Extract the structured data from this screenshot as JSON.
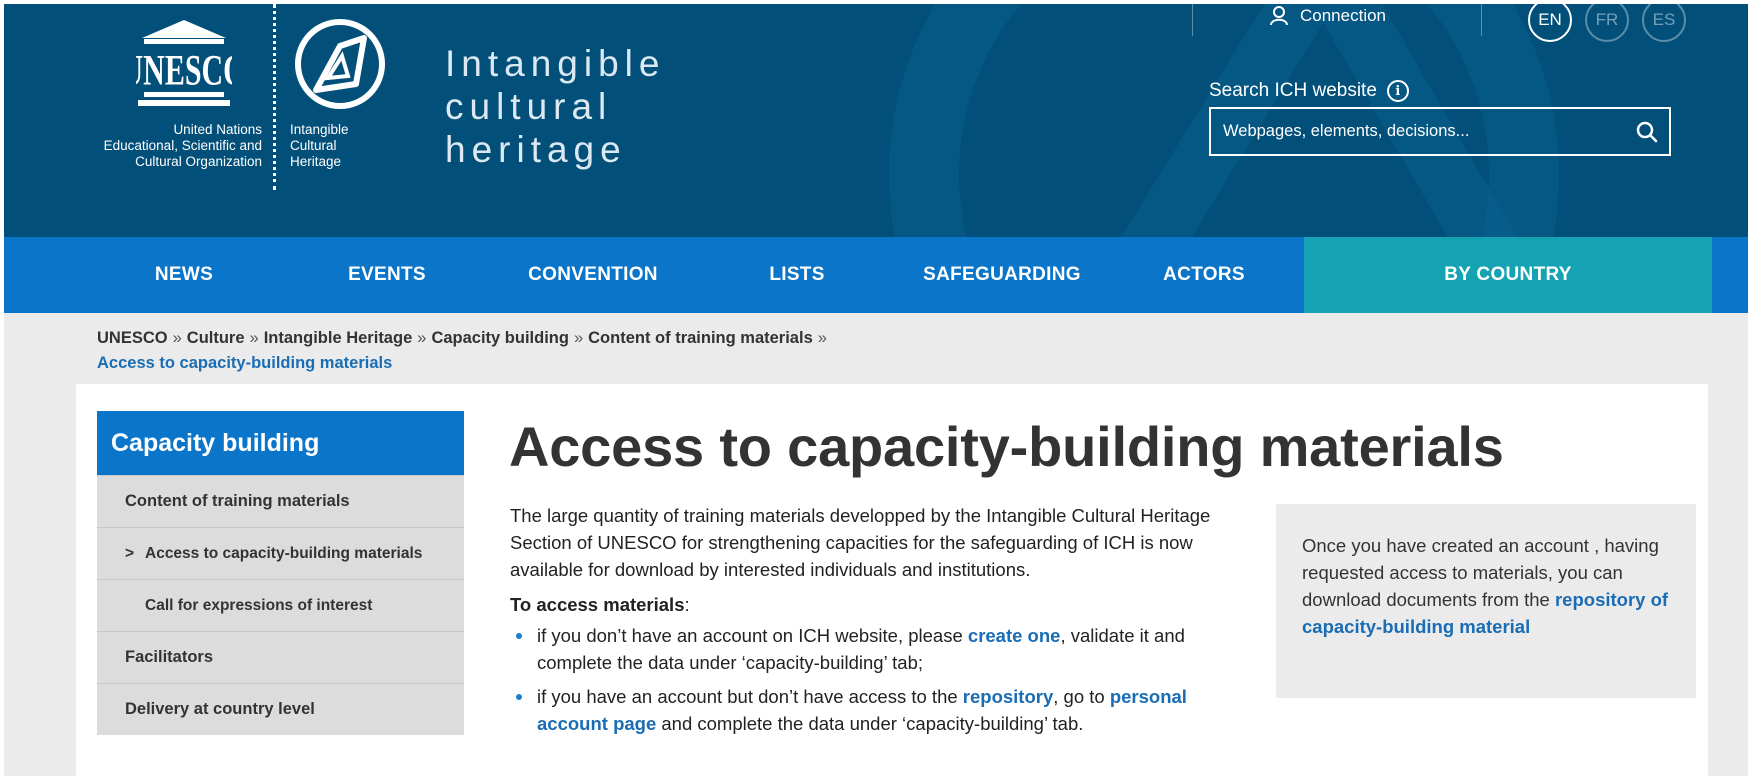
{
  "header": {
    "unesco_logo_text": "UNESCO",
    "unesco_lines": [
      "United Nations",
      "Educational, Scientific and",
      "Cultural Organization"
    ],
    "ich_lines": [
      "Intangible",
      "Cultural",
      "Heritage"
    ],
    "site_title_lines": [
      "Intangible",
      "cultural",
      "heritage"
    ],
    "connection_label": "Connection",
    "languages": [
      "EN",
      "FR",
      "ES"
    ],
    "active_language": "EN",
    "search_label": "Search ICH website",
    "search_placeholder": "Webpages, elements, decisions...",
    "icons": {
      "user": "user-icon",
      "info": "info-icon",
      "search": "search-icon"
    }
  },
  "nav": {
    "items": [
      "NEWS",
      "EVENTS",
      "CONVENTION",
      "LISTS",
      "SAFEGUARDING",
      "ACTORS",
      "BY COUNTRY"
    ]
  },
  "breadcrumb": {
    "items": [
      "UNESCO",
      "Culture",
      "Intangible Heritage",
      "Capacity building",
      "Content of training materials"
    ],
    "separator": "»",
    "current": "Access to capacity-building materials"
  },
  "sidebar": {
    "title": "Capacity building",
    "items": [
      {
        "label": "Content of training materials"
      },
      {
        "label": "Access to capacity-building materials",
        "marker": ">"
      },
      {
        "label": "Call for expressions of interest"
      },
      {
        "label": "Facilitators"
      },
      {
        "label": "Delivery at country level"
      }
    ]
  },
  "main": {
    "title": "Access to capacity-building materials",
    "intro": "The large quantity of training materials developped by the Intangible Cultural Heritage Section of UNESCO for strengthening capacities for the safeguarding of ICH is now available for download by interested individuals and institutions.",
    "access_heading": "To access materials",
    "access_colon": ":",
    "bullet1": {
      "pre": "if you don’t have an account on ICH website, please ",
      "link": "create one",
      "post": ", validate it and complete the data under ‘capacity-building’ tab;"
    },
    "bullet2": {
      "pre": "if you have an account but don’t have access to the ",
      "link1": "repository",
      "mid": ", go to ",
      "link2": "personal account page",
      "post": " and complete the data under ‘capacity-building’ tab."
    }
  },
  "aside": {
    "text": "Once you have created an account , having requested access to materials, you can download documents from the ",
    "link": "repository of capacity-building material"
  },
  "colors": {
    "header_bg": "#02507a",
    "nav_bg": "#0b75c9",
    "nav_country_bg": "#15a3b3",
    "link": "#1a6db5"
  }
}
